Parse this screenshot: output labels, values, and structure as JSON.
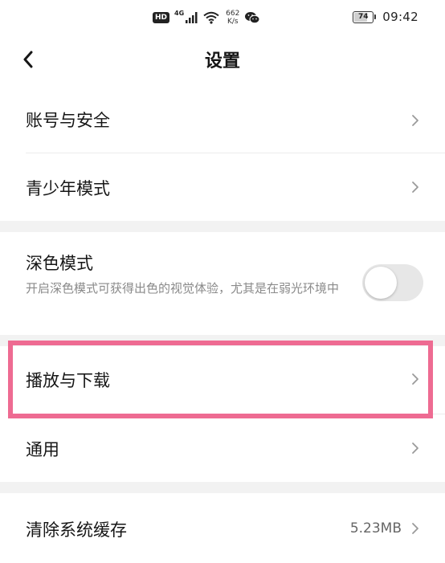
{
  "status_bar": {
    "hd": "HD",
    "network": "4G",
    "speed_value": "662",
    "speed_unit": "K/s",
    "battery": "74",
    "battery_level": 0.74,
    "time": "09:42"
  },
  "header": {
    "title": "设置",
    "back_icon": "chevron-left-icon"
  },
  "settings": {
    "account_security": "账号与安全",
    "teen_mode": "青少年模式",
    "dark_mode": {
      "label": "深色模式",
      "description": "开启深色模式可获得出色的视觉体验，尤其是在弱光环境中",
      "enabled": false
    },
    "play_download": "播放与下载",
    "general": "通用",
    "clear_cache": {
      "label": "清除系统缓存",
      "value": "5.23MB"
    }
  },
  "colors": {
    "highlight": "#ee6b92",
    "section_gap": "#f2f2f2",
    "toggle_off": "#e7e7e7"
  }
}
